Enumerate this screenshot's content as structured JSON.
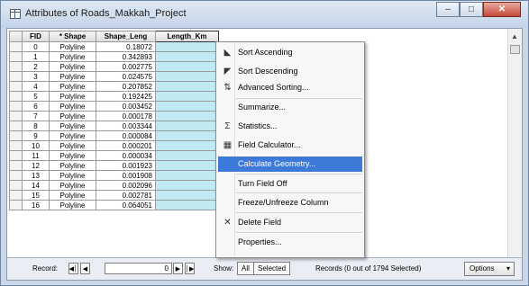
{
  "window": {
    "title": "Attributes of Roads_Makkah_Project"
  },
  "table": {
    "columns": [
      "FID",
      "* Shape",
      "Shape_Leng",
      "Length_Km"
    ],
    "rows": [
      [
        "0",
        "Polyline",
        "0.18072"
      ],
      [
        "1",
        "Polyline",
        "0.342893"
      ],
      [
        "2",
        "Polyline",
        "0.002775"
      ],
      [
        "3",
        "Polyline",
        "0.024575"
      ],
      [
        "4",
        "Polyline",
        "0.207852"
      ],
      [
        "5",
        "Polyline",
        "0.192425"
      ],
      [
        "6",
        "Polyline",
        "0.003452"
      ],
      [
        "7",
        "Polyline",
        "0.000178"
      ],
      [
        "8",
        "Polyline",
        "0.003344"
      ],
      [
        "9",
        "Polyline",
        "0.000084"
      ],
      [
        "10",
        "Polyline",
        "0.000201"
      ],
      [
        "11",
        "Polyline",
        "0.000034"
      ],
      [
        "12",
        "Polyline",
        "0.001923"
      ],
      [
        "13",
        "Polyline",
        "0.001908"
      ],
      [
        "14",
        "Polyline",
        "0.002096"
      ],
      [
        "15",
        "Polyline",
        "0.002781"
      ],
      [
        "16",
        "Polyline",
        "0.064051"
      ]
    ]
  },
  "context_menu": {
    "items": [
      {
        "label": "Sort Ascending",
        "icon": "sort-ascending-icon"
      },
      {
        "label": "Sort Descending",
        "icon": "sort-descending-icon"
      },
      {
        "label": "Advanced Sorting...",
        "icon": "advanced-sort-icon"
      },
      {
        "label": "Summarize...",
        "icon": ""
      },
      {
        "label": "Statistics...",
        "icon": "sigma-icon"
      },
      {
        "label": "Field Calculator...",
        "icon": "calculator-icon"
      },
      {
        "label": "Calculate Geometry...",
        "icon": "",
        "highlighted": true
      },
      {
        "label": "Turn Field Off",
        "icon": ""
      },
      {
        "label": "Freeze/Unfreeze Column",
        "icon": ""
      },
      {
        "label": "Delete Field",
        "icon": "delete-x-icon"
      },
      {
        "label": "Properties...",
        "icon": ""
      }
    ]
  },
  "footer": {
    "records_label": "Record:",
    "record_value": "0",
    "show_label": "Show:",
    "all_label": "All",
    "selected_label": "Selected",
    "status": "Records (0 out of 1794 Selected)",
    "options_label": "Options"
  },
  "colors": {
    "highlight": "#3c79d8",
    "calc_column": "#bfeaf2"
  }
}
